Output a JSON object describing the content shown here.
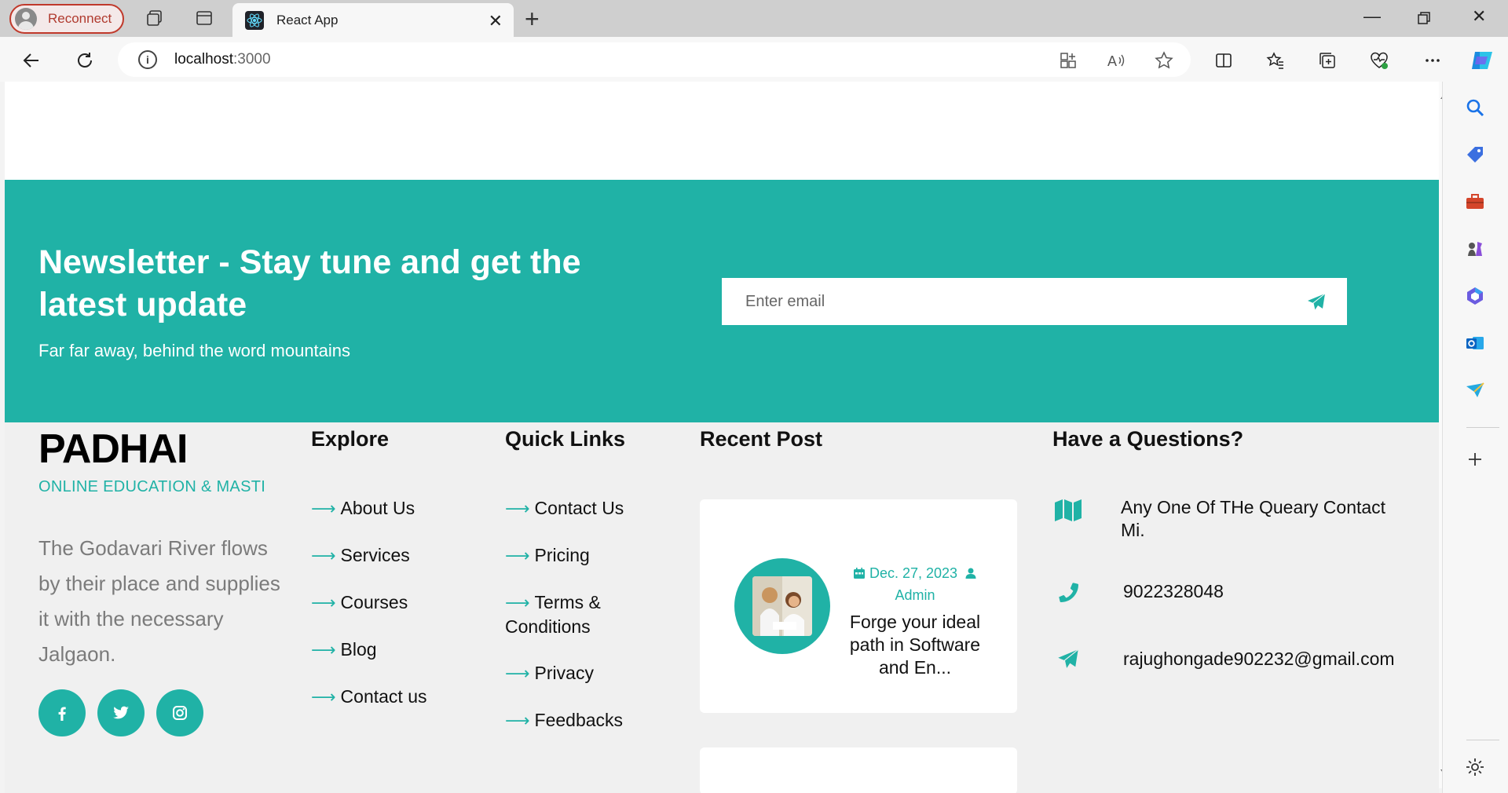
{
  "browser": {
    "reconnect_label": "Reconnect",
    "tab_title": "React App",
    "url_host": "localhost",
    "url_port": ":3000"
  },
  "newsletter": {
    "title": "Newsletter - Stay tune and get the latest update",
    "subtitle": "Far far away, behind the word mountains",
    "email_placeholder": "Enter email"
  },
  "footer": {
    "brand": "PADHAI",
    "tagline": "ONLINE EDUCATION & MASTI",
    "about": "The Godavari River flows by their place and supplies it with the necessary Jalgaon.",
    "explore": {
      "heading": "Explore",
      "links": [
        "About Us",
        "Services",
        "Courses",
        "Blog",
        "Contact us"
      ]
    },
    "quick_links": {
      "heading": "Quick Links",
      "links": [
        "Contact Us",
        "Pricing",
        "Terms & Conditions",
        "Privacy",
        "Feedbacks"
      ]
    },
    "recent_post": {
      "heading": "Recent Post",
      "date": "Dec. 27, 2023",
      "author": "Admin",
      "title": "Forge your ideal path in Software and En..."
    },
    "questions": {
      "heading": "Have a Questions?",
      "address": "Any One Of THe Queary Contact Mi.",
      "phone": "9022328048",
      "email": "rajughongade902232@gmail.com"
    },
    "arrow_glyph": "⟶"
  },
  "colors": {
    "accent": "#20b2a6",
    "reconnect_red": "#c0392b"
  }
}
